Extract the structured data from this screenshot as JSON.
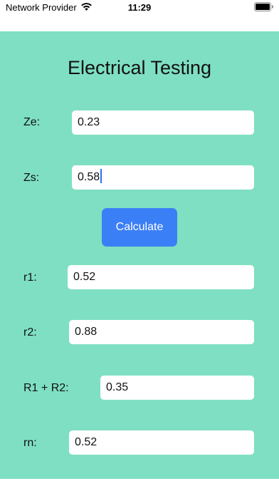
{
  "status_bar": {
    "carrier": "Network Provider",
    "time": "11:29"
  },
  "title": "Electrical Testing",
  "fields": {
    "ze": {
      "label": "Ze:",
      "value": "0.23"
    },
    "zs": {
      "label": "Zs:",
      "value": "0.58"
    },
    "r1": {
      "label": "r1:",
      "value": "0.52"
    },
    "r2": {
      "label": "r2:",
      "value": "0.88"
    },
    "r1r2": {
      "label": "R1 + R2:",
      "value": "0.35"
    },
    "rn": {
      "label": "rn:",
      "value": "0.52"
    }
  },
  "calculate_button": {
    "label": "Calculate"
  },
  "colors": {
    "background": "#7fdfc2",
    "button": "#3b7ff6",
    "caret": "#2f6df6"
  }
}
